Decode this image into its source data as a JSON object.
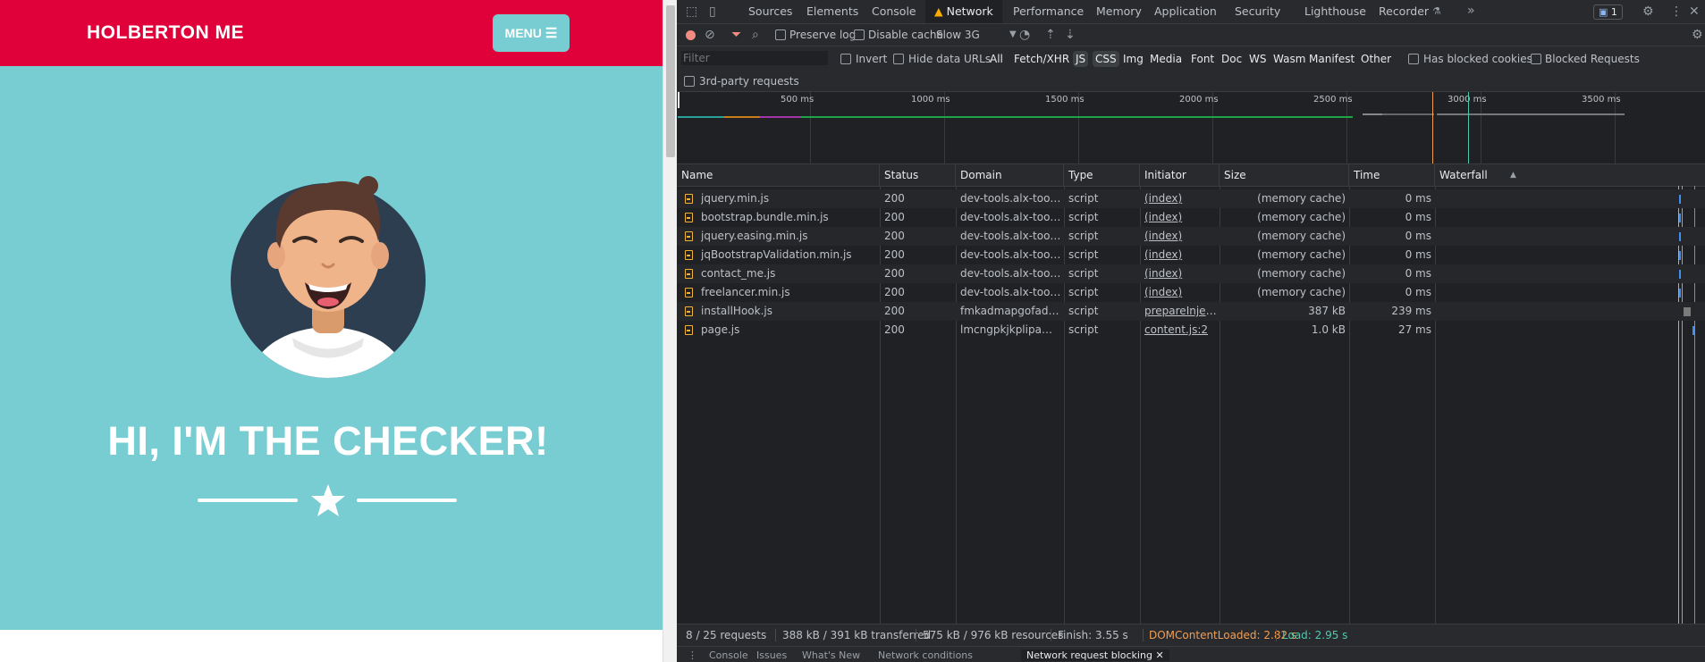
{
  "page": {
    "brand": "HOLBERTON ME",
    "menu_label": "MENU",
    "hero_title": "HI, I'M THE CHECKER!"
  },
  "devtools": {
    "tabs": [
      "Sources",
      "Elements",
      "Console",
      "Network",
      "Performance",
      "Memory",
      "Application",
      "Security",
      "Lighthouse",
      "Recorder"
    ],
    "active_tab": "Network",
    "issues_count": "1",
    "toolbar": {
      "preserve_log": "Preserve log",
      "disable_cache": "Disable cache",
      "throttle": "Slow 3G"
    },
    "filter": {
      "placeholder": "Filter",
      "invert": "Invert",
      "hide_data_urls": "Hide data URLs",
      "types": [
        "All",
        "Fetch/XHR",
        "JS",
        "CSS",
        "Img",
        "Media",
        "Font",
        "Doc",
        "WS",
        "Wasm",
        "Manifest",
        "Other"
      ],
      "selected_types": [
        "JS",
        "CSS"
      ],
      "has_blocked_cookies": "Has blocked cookies",
      "blocked_requests": "Blocked Requests",
      "third_party": "3rd-party requests"
    },
    "overview_ticks": [
      "500 ms",
      "1000 ms",
      "1500 ms",
      "2000 ms",
      "2500 ms",
      "3000 ms",
      "3500 ms"
    ],
    "columns": [
      "Name",
      "Status",
      "Domain",
      "Type",
      "Initiator",
      "Size",
      "Time",
      "Waterfall"
    ],
    "rows": [
      {
        "name": "jquery.min.js",
        "status": "200",
        "domain": "dev-tools.alx-tools.com",
        "type": "script",
        "initiator": "(index)",
        "size": "(memory cache)",
        "time": "0 ms"
      },
      {
        "name": "bootstrap.bundle.min.js",
        "status": "200",
        "domain": "dev-tools.alx-tools.com",
        "type": "script",
        "initiator": "(index)",
        "size": "(memory cache)",
        "time": "0 ms"
      },
      {
        "name": "jquery.easing.min.js",
        "status": "200",
        "domain": "dev-tools.alx-tools.com",
        "type": "script",
        "initiator": "(index)",
        "size": "(memory cache)",
        "time": "0 ms"
      },
      {
        "name": "jqBootstrapValidation.min.js",
        "status": "200",
        "domain": "dev-tools.alx-tools.com",
        "type": "script",
        "initiator": "(index)",
        "size": "(memory cache)",
        "time": "0 ms"
      },
      {
        "name": "contact_me.js",
        "status": "200",
        "domain": "dev-tools.alx-tools.com",
        "type": "script",
        "initiator": "(index)",
        "size": "(memory cache)",
        "time": "0 ms"
      },
      {
        "name": "freelancer.min.js",
        "status": "200",
        "domain": "dev-tools.alx-tools.com",
        "type": "script",
        "initiator": "(index)",
        "size": "(memory cache)",
        "time": "0 ms"
      },
      {
        "name": "installHook.js",
        "status": "200",
        "domain": "fmkadmapgofadopljbjf…",
        "type": "script",
        "initiator": "prepareInjectio…",
        "size": "387 kB",
        "time": "239 ms"
      },
      {
        "name": "page.js",
        "status": "200",
        "domain": "lmcngpkjkplipamgflhio…",
        "type": "script",
        "initiator": "content.js:2",
        "size": "1.0 kB",
        "time": "27 ms"
      }
    ],
    "status": {
      "requests": "8 / 25 requests",
      "transferred": "388 kB / 391 kB transferred",
      "resources": "575 kB / 976 kB resources",
      "finish": "Finish: 3.55 s",
      "dom_loaded": "DOMContentLoaded: 2.82 s",
      "load": "Load: 2.95 s"
    },
    "drawer_tabs": [
      "Console",
      "Issues",
      "What's New",
      "Network conditions",
      "Network request blocking"
    ],
    "colors": {
      "dom_loaded": "#f29e53",
      "load": "#4ec9b0",
      "brand_red": "#e0003a",
      "hero_teal": "#78cdd2"
    }
  }
}
